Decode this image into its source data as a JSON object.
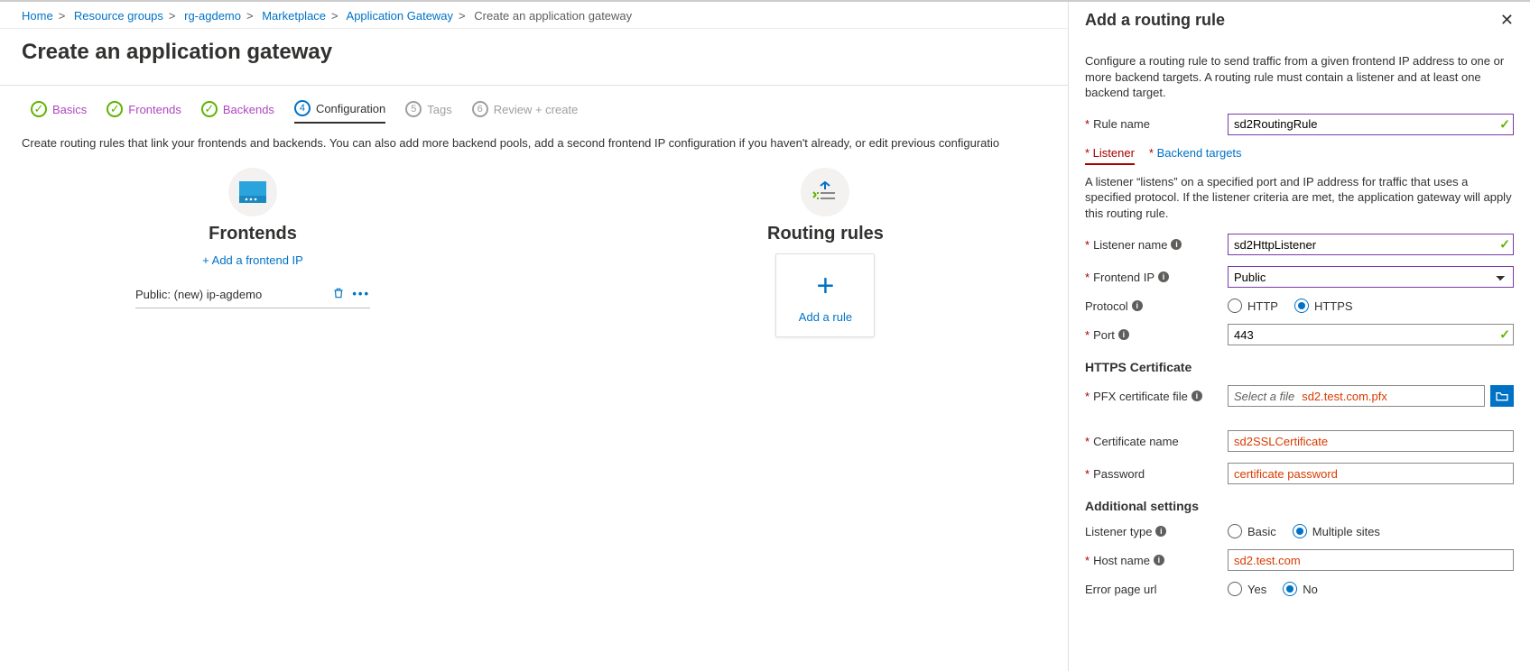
{
  "breadcrumbs": [
    "Home",
    "Resource groups",
    "rg-agdemo",
    "Marketplace",
    "Application Gateway",
    "Create an application gateway"
  ],
  "page_title": "Create an application gateway",
  "tabs": [
    {
      "state": "done",
      "num": "",
      "label": "Basics"
    },
    {
      "state": "done",
      "num": "",
      "label": "Frontends"
    },
    {
      "state": "done",
      "num": "",
      "label": "Backends"
    },
    {
      "state": "cur",
      "num": "4",
      "label": "Configuration"
    },
    {
      "state": "pend",
      "num": "5",
      "label": "Tags"
    },
    {
      "state": "pend",
      "num": "6",
      "label": "Review + create"
    }
  ],
  "description": "Create routing rules that link your frontends and backends. You can also add more backend pools, add a second frontend IP configuration if you haven't already, or edit previous configuratio",
  "frontends": {
    "title": "Frontends",
    "add_link": "+ Add a frontend IP",
    "items": [
      {
        "label": "Public: (new) ip-agdemo"
      }
    ]
  },
  "routing": {
    "title": "Routing rules",
    "card_label": "Add a rule"
  },
  "panel": {
    "title": "Add a routing rule",
    "intro": "Configure a routing rule to send traffic from a given frontend IP address to one or more backend targets. A routing rule must contain a listener and at least one backend target.",
    "rule_name": {
      "label": "Rule name",
      "value": "sd2RoutingRule"
    },
    "subtabs": {
      "listener": "Listener",
      "backend": "Backend targets"
    },
    "listener_intro": "A listener “listens” on a specified port and IP address for traffic that uses a specified protocol. If the listener criteria are met, the application gateway will apply this routing rule.",
    "listener_name": {
      "label": "Listener name",
      "value": "sd2HttpListener"
    },
    "frontend_ip": {
      "label": "Frontend IP",
      "value": "Public"
    },
    "protocol": {
      "label": "Protocol",
      "opts": [
        "HTTP",
        "HTTPS"
      ],
      "selected": "HTTPS"
    },
    "port": {
      "label": "Port",
      "value": "443"
    },
    "https_section": "HTTPS Certificate",
    "pfx": {
      "label": "PFX certificate file",
      "placeholder": "Select a file",
      "filename": "sd2.test.com.pfx"
    },
    "cert_name": {
      "label": "Certificate name",
      "value": "sd2SSLCertificate"
    },
    "password": {
      "label": "Password",
      "value": "certificate password"
    },
    "additional_section": "Additional settings",
    "listener_type": {
      "label": "Listener type",
      "opts": [
        "Basic",
        "Multiple sites"
      ],
      "selected": "Multiple sites"
    },
    "host_name": {
      "label": "Host name",
      "value": "sd2.test.com"
    },
    "error_url": {
      "label": "Error page url",
      "opts": [
        "Yes",
        "No"
      ],
      "selected": "No"
    }
  }
}
